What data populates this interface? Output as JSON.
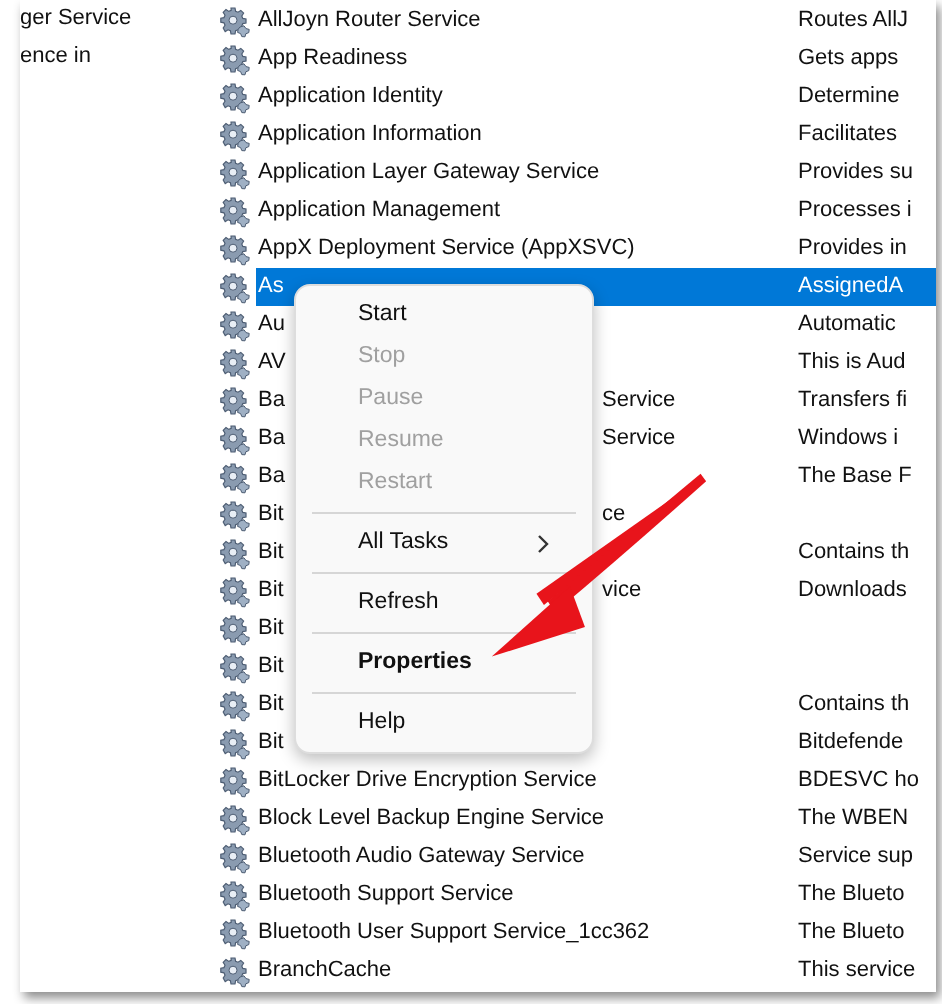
{
  "description_pane": {
    "lines": [
      "ger Service",
      "ence in"
    ]
  },
  "services": [
    {
      "name": "AllJoyn Router Service",
      "description": "Routes AllJ",
      "selected": false
    },
    {
      "name": "App Readiness",
      "description": "Gets apps",
      "selected": false
    },
    {
      "name": "Application Identity",
      "description": "Determine",
      "selected": false
    },
    {
      "name": "Application Information",
      "description": "Facilitates",
      "selected": false
    },
    {
      "name": "Application Layer Gateway Service",
      "description": "Provides su",
      "selected": false
    },
    {
      "name": "Application Management",
      "description": "Processes i",
      "selected": false
    },
    {
      "name": "AppX Deployment Service (AppXSVC)",
      "description": "Provides in",
      "selected": false
    },
    {
      "name": "As",
      "description": "AssignedA",
      "selected": true
    },
    {
      "name": "Au",
      "description": "Automatic",
      "selected": false
    },
    {
      "name": "AV",
      "description": "This is Aud",
      "selected": false
    },
    {
      "name": "Ba",
      "name_tail": "Service",
      "description": "Transfers fi",
      "selected": false
    },
    {
      "name": "Ba",
      "name_tail": "Service",
      "description": "Windows i",
      "selected": false
    },
    {
      "name": "Ba",
      "description": "The Base F",
      "selected": false
    },
    {
      "name": "Bit",
      "name_tail": "ce",
      "selected": false
    },
    {
      "name": "Bit",
      "description": "Contains th",
      "selected": false
    },
    {
      "name": "Bit",
      "name_tail": "vice",
      "description": "Downloads",
      "selected": false
    },
    {
      "name": "Bit",
      "selected": false
    },
    {
      "name": "Bit",
      "selected": false
    },
    {
      "name": "Bit",
      "description": "Contains th",
      "selected": false
    },
    {
      "name": "Bit",
      "description": "Bitdefende",
      "selected": false
    },
    {
      "name": "BitLocker Drive Encryption Service",
      "description": "BDESVC ho",
      "selected": false
    },
    {
      "name": "Block Level Backup Engine Service",
      "description": "The WBEN",
      "selected": false
    },
    {
      "name": "Bluetooth Audio Gateway Service",
      "description": "Service sup",
      "selected": false
    },
    {
      "name": "Bluetooth Support Service",
      "description": "The Blueto",
      "selected": false
    },
    {
      "name": "Bluetooth User Support Service_1cc362",
      "description": "The Blueto",
      "selected": false
    },
    {
      "name": "BranchCache",
      "description": "This service",
      "selected": false
    }
  ],
  "context_menu": {
    "items": [
      {
        "kind": "item",
        "label": "Start",
        "disabled": false
      },
      {
        "kind": "item",
        "label": "Stop",
        "disabled": true
      },
      {
        "kind": "item",
        "label": "Pause",
        "disabled": true
      },
      {
        "kind": "item",
        "label": "Resume",
        "disabled": true
      },
      {
        "kind": "item",
        "label": "Restart",
        "disabled": true
      },
      {
        "kind": "separator"
      },
      {
        "kind": "submenu",
        "label": "All Tasks",
        "disabled": false
      },
      {
        "kind": "separator"
      },
      {
        "kind": "item",
        "label": "Refresh",
        "disabled": false
      },
      {
        "kind": "separator"
      },
      {
        "kind": "default",
        "label": "Properties",
        "disabled": false
      },
      {
        "kind": "separator"
      },
      {
        "kind": "item",
        "label": "Help",
        "disabled": false
      }
    ]
  },
  "annotations": [
    {
      "kind": "arrow"
    }
  ]
}
